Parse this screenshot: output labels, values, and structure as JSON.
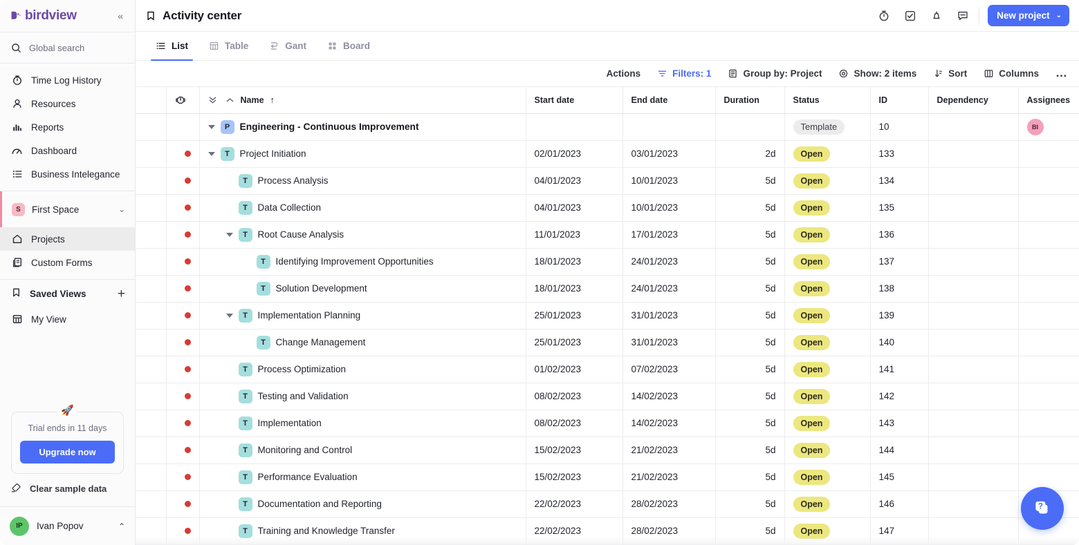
{
  "app": {
    "logo_text": "birdview",
    "collapse_glyph": "«"
  },
  "sidebar": {
    "search": {
      "placeholder": "Global search",
      "icon": "search-icon"
    },
    "nav": [
      {
        "label": "Time Log History",
        "icon": "stopwatch-icon"
      },
      {
        "label": "Resources",
        "icon": "person-icon"
      },
      {
        "label": "Reports",
        "icon": "bar-chart-icon"
      },
      {
        "label": "Dashboard",
        "icon": "gauge-icon"
      },
      {
        "label": "Business Intelegance",
        "icon": "list-icon"
      }
    ],
    "space": {
      "initial": "S",
      "name": "First Space",
      "chevron": "⌄"
    },
    "space_items": [
      {
        "label": "Projects",
        "icon": "home-icon",
        "active": true
      },
      {
        "label": "Custom Forms",
        "icon": "forms-icon",
        "active": false
      }
    ],
    "saved_views": {
      "title": "Saved Views",
      "add_glyph": "+",
      "items": [
        {
          "label": "My View",
          "icon": "table-icon"
        }
      ]
    },
    "trial": {
      "text": "Trial ends in 11 days",
      "button_label": "Upgrade now",
      "rocket_icon": "rocket-icon"
    },
    "clear_sample": {
      "label": "Clear sample data",
      "icon": "eraser-icon"
    },
    "user": {
      "initials": "IP",
      "name": "Ivan Popov",
      "chevron": "⌃"
    }
  },
  "header": {
    "title": "Activity center",
    "title_icon": "bookmark-icon",
    "icons": [
      {
        "name": "stopwatch-icon"
      },
      {
        "name": "checkbox-icon"
      },
      {
        "name": "bell-icon"
      },
      {
        "name": "comment-icon"
      }
    ],
    "new_project": {
      "label": "New project",
      "chevron": "⌄"
    }
  },
  "tabs": [
    {
      "label": "List",
      "icon": "list-icon",
      "active": true
    },
    {
      "label": "Table",
      "icon": "table-icon",
      "active": false
    },
    {
      "label": "Gant",
      "icon": "gantt-icon",
      "active": false
    },
    {
      "label": "Board",
      "icon": "board-icon",
      "active": false
    }
  ],
  "toolbar": [
    {
      "label": "Actions",
      "icon": null,
      "highlight": false
    },
    {
      "label": "Filters: 1",
      "icon": "filter-icon",
      "highlight": true
    },
    {
      "label": "Group by: Project",
      "icon": "group-icon",
      "highlight": false
    },
    {
      "label": "Show: 2 items",
      "icon": "eye-icon",
      "highlight": false
    },
    {
      "label": "Sort",
      "icon": "sort-icon",
      "highlight": false
    },
    {
      "label": "Columns",
      "icon": "columns-icon",
      "highlight": false
    },
    {
      "label": "…",
      "icon": "more-icon",
      "highlight": false
    }
  ],
  "table": {
    "columns": [
      {
        "key": "spacer",
        "label": ""
      },
      {
        "key": "flag",
        "label": "",
        "icon": "alert-power-icon"
      },
      {
        "key": "name",
        "label": "Name",
        "sort": "↑",
        "expand_icon": "expand-all-icon",
        "collapse_icon": "collapse-all-icon"
      },
      {
        "key": "start",
        "label": "Start date"
      },
      {
        "key": "end",
        "label": "End date"
      },
      {
        "key": "duration",
        "label": "Duration"
      },
      {
        "key": "status",
        "label": "Status"
      },
      {
        "key": "id",
        "label": "ID"
      },
      {
        "key": "dependency",
        "label": "Dependency"
      },
      {
        "key": "assignees",
        "label": "Assignees"
      }
    ],
    "group": {
      "badge": "P",
      "name": "Engineering - Continuous Improvement",
      "start": "",
      "end": "",
      "duration": "",
      "status": "Template",
      "id": "10",
      "dependency": "",
      "assignee": "BI",
      "caret": true
    },
    "rows": [
      {
        "badge": "T",
        "name": "Project Initiation",
        "indent": 0,
        "caret": true,
        "dot": true,
        "start": "02/01/2023",
        "end": "03/01/2023",
        "duration": "2d",
        "status": "Open",
        "id": "133",
        "dependency": "",
        "assignee": ""
      },
      {
        "badge": "T",
        "name": "Process Analysis",
        "indent": 1,
        "caret": false,
        "dot": true,
        "start": "04/01/2023",
        "end": "10/01/2023",
        "duration": "5d",
        "status": "Open",
        "id": "134",
        "dependency": "",
        "assignee": ""
      },
      {
        "badge": "T",
        "name": "Data Collection",
        "indent": 1,
        "caret": false,
        "dot": true,
        "start": "04/01/2023",
        "end": "10/01/2023",
        "duration": "5d",
        "status": "Open",
        "id": "135",
        "dependency": "",
        "assignee": ""
      },
      {
        "badge": "T",
        "name": "Root Cause Analysis",
        "indent": 1,
        "caret": true,
        "dot": true,
        "start": "11/01/2023",
        "end": "17/01/2023",
        "duration": "5d",
        "status": "Open",
        "id": "136",
        "dependency": "",
        "assignee": ""
      },
      {
        "badge": "T",
        "name": "Identifying Improvement Opportunities",
        "indent": 2,
        "caret": false,
        "dot": true,
        "start": "18/01/2023",
        "end": "24/01/2023",
        "duration": "5d",
        "status": "Open",
        "id": "137",
        "dependency": "",
        "assignee": ""
      },
      {
        "badge": "T",
        "name": "Solution Development",
        "indent": 2,
        "caret": false,
        "dot": true,
        "start": "18/01/2023",
        "end": "24/01/2023",
        "duration": "5d",
        "status": "Open",
        "id": "138",
        "dependency": "",
        "assignee": ""
      },
      {
        "badge": "T",
        "name": "Implementation Planning",
        "indent": 1,
        "caret": true,
        "dot": true,
        "start": "25/01/2023",
        "end": "31/01/2023",
        "duration": "5d",
        "status": "Open",
        "id": "139",
        "dependency": "",
        "assignee": ""
      },
      {
        "badge": "T",
        "name": "Change Management",
        "indent": 2,
        "caret": false,
        "dot": true,
        "start": "25/01/2023",
        "end": "31/01/2023",
        "duration": "5d",
        "status": "Open",
        "id": "140",
        "dependency": "",
        "assignee": ""
      },
      {
        "badge": "T",
        "name": "Process Optimization",
        "indent": 1,
        "caret": false,
        "dot": true,
        "start": "01/02/2023",
        "end": "07/02/2023",
        "duration": "5d",
        "status": "Open",
        "id": "141",
        "dependency": "",
        "assignee": ""
      },
      {
        "badge": "T",
        "name": "Testing and Validation",
        "indent": 1,
        "caret": false,
        "dot": true,
        "start": "08/02/2023",
        "end": "14/02/2023",
        "duration": "5d",
        "status": "Open",
        "id": "142",
        "dependency": "",
        "assignee": ""
      },
      {
        "badge": "T",
        "name": "Implementation",
        "indent": 1,
        "caret": false,
        "dot": true,
        "start": "08/02/2023",
        "end": "14/02/2023",
        "duration": "5d",
        "status": "Open",
        "id": "143",
        "dependency": "",
        "assignee": ""
      },
      {
        "badge": "T",
        "name": "Monitoring and Control",
        "indent": 1,
        "caret": false,
        "dot": true,
        "start": "15/02/2023",
        "end": "21/02/2023",
        "duration": "5d",
        "status": "Open",
        "id": "144",
        "dependency": "",
        "assignee": ""
      },
      {
        "badge": "T",
        "name": "Performance Evaluation",
        "indent": 1,
        "caret": false,
        "dot": true,
        "start": "15/02/2023",
        "end": "21/02/2023",
        "duration": "5d",
        "status": "Open",
        "id": "145",
        "dependency": "",
        "assignee": ""
      },
      {
        "badge": "T",
        "name": "Documentation and Reporting",
        "indent": 1,
        "caret": false,
        "dot": true,
        "start": "22/02/2023",
        "end": "28/02/2023",
        "duration": "5d",
        "status": "Open",
        "id": "146",
        "dependency": "",
        "assignee": ""
      },
      {
        "badge": "T",
        "name": "Training and Knowledge Transfer",
        "indent": 1,
        "caret": false,
        "dot": true,
        "start": "22/02/2023",
        "end": "28/02/2023",
        "duration": "5d",
        "status": "Open",
        "id": "147",
        "dependency": "",
        "assignee": ""
      }
    ]
  },
  "help_fab": {
    "icon": "help-card-icon"
  },
  "colors": {
    "accent": "#4a6cf7",
    "logo": "#6b4aa0",
    "end_date": "#e0352b",
    "status_open_bg": "#ece77f",
    "status_template_bg": "#ececed",
    "badge_project": "#a6c3fb",
    "badge_task": "#a5dede",
    "dot": "#d93a35"
  }
}
